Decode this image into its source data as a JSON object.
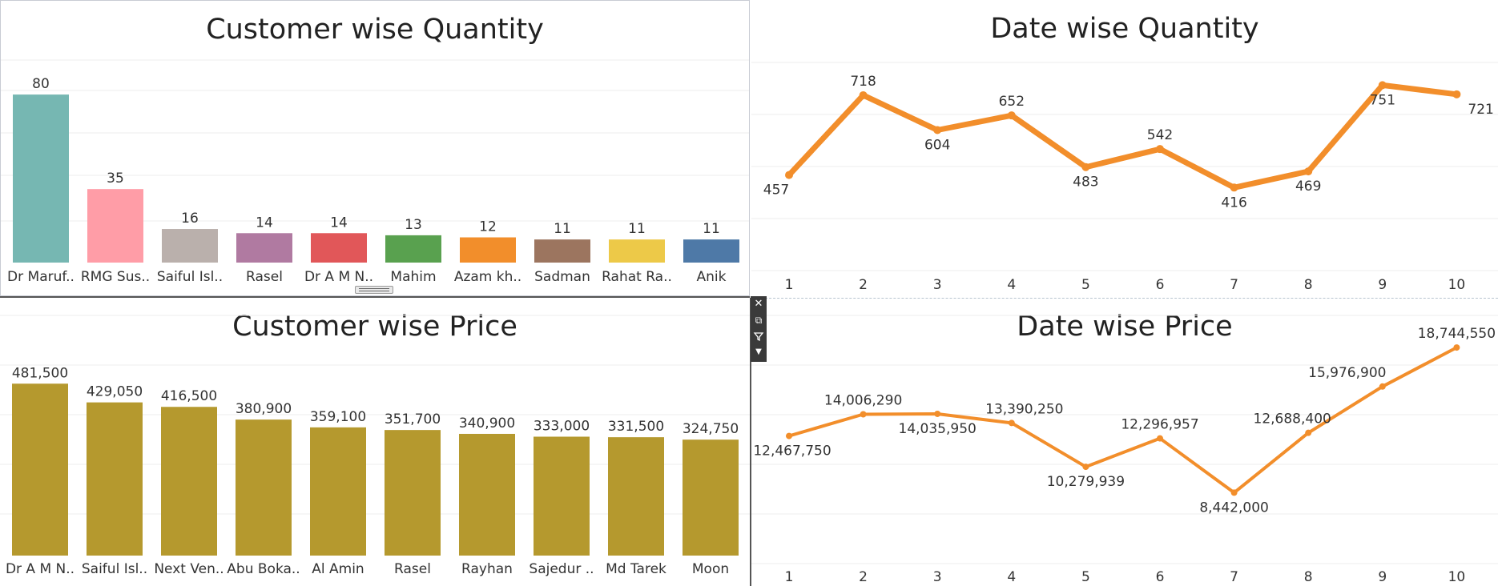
{
  "panels": {
    "customer_qty_title": "Customer wise Quantity",
    "date_qty_title": "Date wise Quantity",
    "customer_price_title": "Customer wise Price",
    "date_price_title": "Date wise Price"
  },
  "toolbar": {
    "close_icon": "close-icon",
    "open_icon": "external-open-icon",
    "filter_icon": "filter-icon",
    "menu_icon": "dropdown-arrow-icon"
  },
  "chart_data": [
    {
      "id": "customer_qty",
      "type": "bar",
      "title": "Customer wise Quantity",
      "categories": [
        "Dr Maruf..",
        "RMG Sus..",
        "Saiful Isl..",
        "Rasel",
        "Dr A M N..",
        "Mahim",
        "Azam kh..",
        "Sadman",
        "Rahat Ra..",
        "Anik"
      ],
      "values": [
        80,
        35,
        16,
        14,
        14,
        13,
        12,
        11,
        11,
        11
      ],
      "labels": [
        "80",
        "35",
        "16",
        "14",
        "14",
        "13",
        "12",
        "11",
        "11",
        "11"
      ],
      "colors": [
        "#76b7b2",
        "#ff9da7",
        "#bab0ac",
        "#b07aa1",
        "#e15759",
        "#59a14f",
        "#f28e2b",
        "#9c755f",
        "#edc948",
        "#4e79a7"
      ],
      "ylim": [
        0,
        85
      ],
      "grid": true
    },
    {
      "id": "date_qty",
      "type": "line",
      "title": "Date wise Quantity",
      "x": [
        1,
        2,
        3,
        4,
        5,
        6,
        7,
        8,
        9,
        10
      ],
      "values": [
        457,
        718,
        604,
        652,
        483,
        542,
        416,
        469,
        751,
        721
      ],
      "labels": [
        "457",
        "718",
        "604",
        "652",
        "483",
        "542",
        "416",
        "469",
        "751",
        "721"
      ],
      "color": "#f28e2b",
      "ylim": [
        100,
        820
      ],
      "grid": true
    },
    {
      "id": "customer_price",
      "type": "bar",
      "title": "Customer wise Price",
      "categories": [
        "Dr A M N..",
        "Saiful Isl..",
        "Next Ven..",
        "Abu Boka..",
        "Al Amin",
        "Rasel",
        "Rayhan",
        "Sajedur ..",
        "Md Tarek",
        "Moon"
      ],
      "values": [
        481500,
        429050,
        416500,
        380900,
        359100,
        351700,
        340900,
        333000,
        331500,
        324750
      ],
      "labels": [
        "481,500",
        "429,050",
        "416,500",
        "380,900",
        "359,100",
        "351,700",
        "340,900",
        "333,000",
        "331,500",
        "324,750"
      ],
      "color": "#b5992e",
      "ylim": [
        0,
        500000
      ],
      "grid": true
    },
    {
      "id": "date_price",
      "type": "line",
      "title": "Date wise Price",
      "x": [
        1,
        2,
        3,
        4,
        5,
        6,
        7,
        8,
        9,
        10
      ],
      "values": [
        12467750,
        14006290,
        14035950,
        13390250,
        10279939,
        12296957,
        8442000,
        12688400,
        15976900,
        18744550
      ],
      "labels": [
        "12,467,750",
        "14,006,290",
        "14,035,950",
        "13,390,250",
        "10,279,939",
        "12,296,957",
        "8,442,000",
        "12,688,400",
        "15,976,900",
        "18,744,550"
      ],
      "color": "#f28e2b",
      "ylim": [
        0,
        20000000
      ],
      "grid": true
    }
  ]
}
